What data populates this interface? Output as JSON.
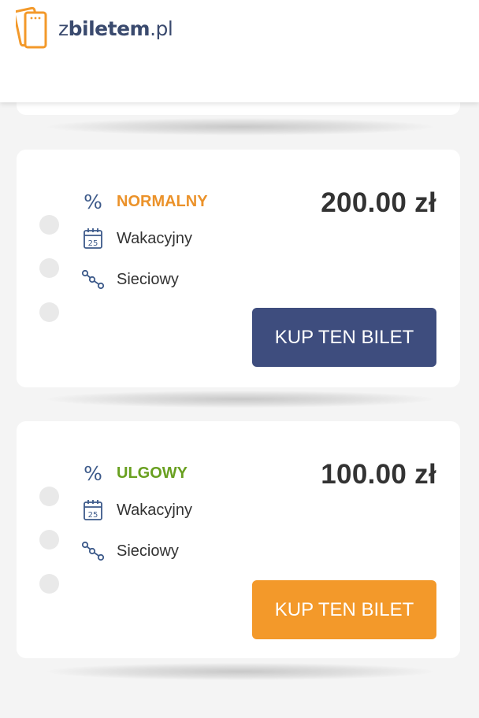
{
  "header": {
    "logo_prefix": "z",
    "logo_bold": "biletem",
    "logo_suffix": ".pl"
  },
  "colors": {
    "brand_orange": "#f3992a",
    "navy_button": "#3e4d7e",
    "normalny_label": "#eb922a",
    "ulgowy_label": "#69a020"
  },
  "tickets": [
    {
      "type_label": "NORMALNY",
      "type_color": "#eb922a",
      "season": "Wakacyjny",
      "network": "Sieciowy",
      "price": "200.00 zł",
      "button_label": "KUP TEN BILET",
      "button_color": "#3e4d7e"
    },
    {
      "type_label": "ULGOWY",
      "type_color": "#69a020",
      "season": "Wakacyjny",
      "network": "Sieciowy",
      "price": "100.00 zł",
      "button_label": "KUP TEN BILET",
      "button_color": "#f3992a"
    }
  ],
  "icons": {
    "type": "percent-icon",
    "season": "calendar-icon",
    "network": "network-icon"
  }
}
